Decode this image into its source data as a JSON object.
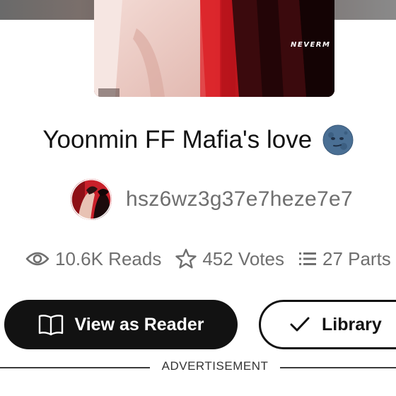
{
  "cover": {
    "overlay_text": "NEVERM"
  },
  "story": {
    "title": "Yoonmin FF Mafia's love",
    "title_emoji_icon": "new-moon-face-icon"
  },
  "author": {
    "username": "hsz6wz3g37e7heze7e7"
  },
  "stats": {
    "reads": "10.6K Reads",
    "votes": "452 Votes",
    "parts": "27 Parts"
  },
  "buttons": {
    "view_as_reader": "View as Reader",
    "library": "Library"
  },
  "ad": {
    "label": "ADVERTISEMENT"
  },
  "colors": {
    "primary_button_bg": "#121212",
    "muted_text": "#6f6f6f",
    "cover_red": "#c8161c"
  }
}
